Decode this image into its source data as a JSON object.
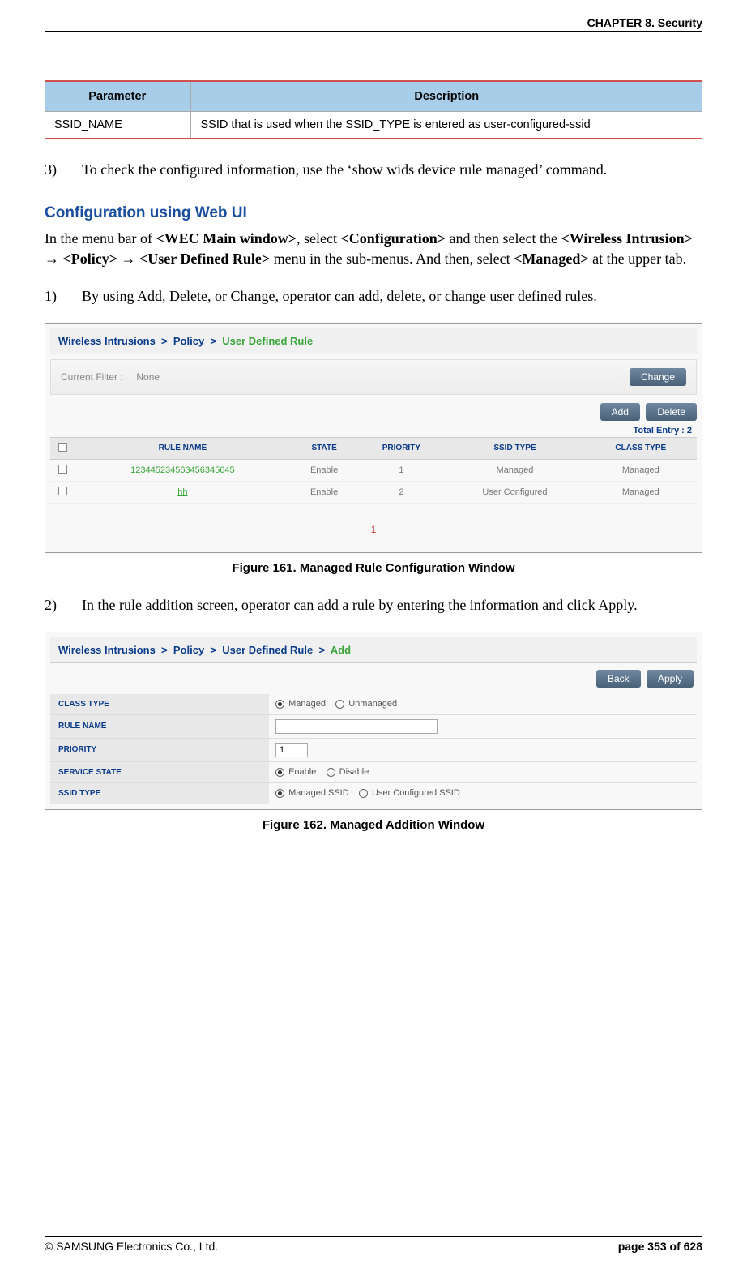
{
  "header": {
    "chapter": "CHAPTER 8. Security"
  },
  "paramTable": {
    "headers": [
      "Parameter",
      "Description"
    ],
    "rows": [
      {
        "param": "SSID_NAME",
        "desc": "SSID that is used when the SSID_TYPE is entered as user-configured-ssid"
      }
    ]
  },
  "step3": {
    "num": "3)",
    "text": "To check the configured information, use the ‘show wids device rule managed’ command."
  },
  "sectionHeading": "Configuration using Web UI",
  "introPara": {
    "t1": "In the menu bar of ",
    "b1": "<WEC Main window>",
    "t2": ", select ",
    "b2": "<Configuration>",
    "t3": " and then select the ",
    "b3": "<Wireless Intrusion>",
    "arrow1": " → ",
    "b4": "<Policy>",
    "arrow2": " → ",
    "b5": "<User Defined Rule>",
    "t4": " menu in the sub-menus. And then, select ",
    "b6": "<Managed>",
    "t5": " at the upper tab."
  },
  "step1": {
    "num": "1)",
    "text": "By using Add, Delete, or Change, operator can add, delete, or change user defined rules."
  },
  "screenshot1": {
    "breadcrumb": {
      "p1": "Wireless Intrusions",
      "sep": ">",
      "p2": "Policy",
      "p3": "User Defined Rule"
    },
    "filterLabel": "Current Filter :",
    "filterValue": "None",
    "changeBtn": "Change",
    "addBtn": "Add",
    "deleteBtn": "Delete",
    "totalEntry": "Total Entry : 2",
    "columns": [
      "",
      "RULE NAME",
      "STATE",
      "PRIORITY",
      "SSID TYPE",
      "CLASS TYPE"
    ],
    "rows": [
      {
        "name": "123445234563456345645",
        "state": "Enable",
        "priority": "1",
        "ssid": "Managed",
        "cls": "Managed"
      },
      {
        "name": "hh",
        "state": "Enable",
        "priority": "2",
        "ssid": "User Configured",
        "cls": "Managed"
      }
    ],
    "pager": "1"
  },
  "figure1Caption": "Figure 161. Managed Rule Configuration Window",
  "step2": {
    "num": "2)",
    "text": "In the rule addition screen, operator can add a rule by entering the information and click Apply."
  },
  "screenshot2": {
    "breadcrumb": {
      "p1": "Wireless Intrusions",
      "sep": ">",
      "p2": "Policy",
      "p3": "User Defined Rule",
      "p4": "Add"
    },
    "backBtn": "Back",
    "applyBtn": "Apply",
    "fields": {
      "classType": {
        "label": "CLASS TYPE",
        "opt1": "Managed",
        "opt2": "Unmanaged"
      },
      "ruleName": {
        "label": "RULE NAME",
        "value": ""
      },
      "priority": {
        "label": "PRIORITY",
        "value": "1"
      },
      "serviceState": {
        "label": "SERVICE STATE",
        "opt1": "Enable",
        "opt2": "Disable"
      },
      "ssidType": {
        "label": "SSID TYPE",
        "opt1": "Managed SSID",
        "opt2": "User Configured SSID"
      }
    }
  },
  "figure2Caption": "Figure 162. Managed Addition Window",
  "footer": {
    "copyright": "© SAMSUNG Electronics Co., Ltd.",
    "page": "page 353 of 628"
  }
}
